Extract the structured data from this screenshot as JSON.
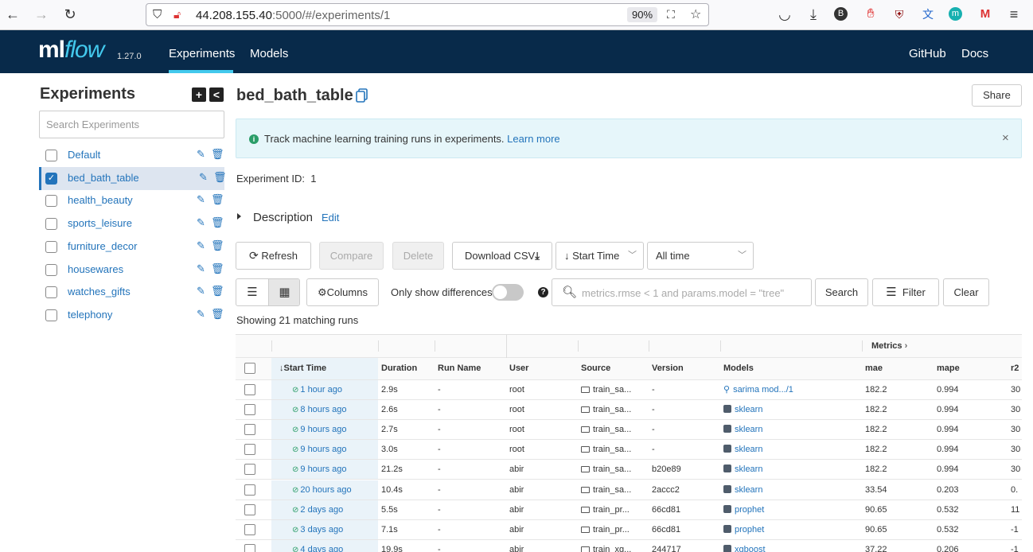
{
  "browser": {
    "url_host": "44.208.155.40",
    "url_rest": ":5000/#/experiments/1",
    "zoom": "90%"
  },
  "header": {
    "logo_ml": "ml",
    "logo_flow": "flow",
    "version": "1.27.0",
    "nav": [
      "Experiments",
      "Models"
    ],
    "right_links": [
      "GitHub",
      "Docs"
    ]
  },
  "sidebar": {
    "title": "Experiments",
    "search_placeholder": "Search Experiments",
    "items": [
      {
        "label": "Default",
        "checked": false
      },
      {
        "label": "bed_bath_table",
        "checked": true
      },
      {
        "label": "health_beauty",
        "checked": false
      },
      {
        "label": "sports_leisure",
        "checked": false
      },
      {
        "label": "furniture_decor",
        "checked": false
      },
      {
        "label": "housewares",
        "checked": false
      },
      {
        "label": "watches_gifts",
        "checked": false
      },
      {
        "label": "telephony",
        "checked": false
      }
    ]
  },
  "main": {
    "title": "bed_bath_table",
    "share": "Share",
    "banner_text": "Track machine learning training runs in experiments.",
    "banner_link": "Learn more",
    "experiment_id_label": "Experiment ID:",
    "experiment_id": "1",
    "description_label": "Description",
    "description_edit": "Edit",
    "toolbar": {
      "refresh": "Refresh",
      "compare": "Compare",
      "delete": "Delete",
      "download": "Download CSV",
      "sort": "Start Time",
      "time_range": "All time",
      "columns": "Columns",
      "only_diff": "Only show differences",
      "search_placeholder": "metrics.rmse < 1 and params.model = \"tree\"",
      "search": "Search",
      "filter": "Filter",
      "clear": "Clear"
    },
    "showing": "Showing 21 matching runs",
    "table": {
      "metrics_group": "Metrics",
      "columns": [
        "Start Time",
        "Duration",
        "Run Name",
        "User",
        "Source",
        "Version",
        "Models",
        "mae",
        "mape",
        "r2"
      ],
      "rows": [
        {
          "start": "1 hour ago",
          "duration": "2.9s",
          "run": "-",
          "user": "root",
          "source": "train_sa...",
          "version": "-",
          "model": "sarima mod.../1",
          "mae": "182.2",
          "mape": "0.994",
          "r2": "30"
        },
        {
          "start": "8 hours ago",
          "duration": "2.6s",
          "run": "-",
          "user": "root",
          "source": "train_sa...",
          "version": "-",
          "model": "sklearn",
          "mae": "182.2",
          "mape": "0.994",
          "r2": "30"
        },
        {
          "start": "9 hours ago",
          "duration": "2.7s",
          "run": "-",
          "user": "root",
          "source": "train_sa...",
          "version": "-",
          "model": "sklearn",
          "mae": "182.2",
          "mape": "0.994",
          "r2": "30"
        },
        {
          "start": "9 hours ago",
          "duration": "3.0s",
          "run": "-",
          "user": "root",
          "source": "train_sa...",
          "version": "-",
          "model": "sklearn",
          "mae": "182.2",
          "mape": "0.994",
          "r2": "30"
        },
        {
          "start": "9 hours ago",
          "duration": "21.2s",
          "run": "-",
          "user": "abir",
          "source": "train_sa...",
          "version": "b20e89",
          "model": "sklearn",
          "mae": "182.2",
          "mape": "0.994",
          "r2": "30"
        },
        {
          "start": "20 hours ago",
          "duration": "10.4s",
          "run": "-",
          "user": "abir",
          "source": "train_sa...",
          "version": "2accc2",
          "model": "sklearn",
          "mae": "33.54",
          "mape": "0.203",
          "r2": "0."
        },
        {
          "start": "2 days ago",
          "duration": "5.5s",
          "run": "-",
          "user": "abir",
          "source": "train_pr...",
          "version": "66cd81",
          "model": "prophet",
          "mae": "90.65",
          "mape": "0.532",
          "r2": "11"
        },
        {
          "start": "3 days ago",
          "duration": "7.1s",
          "run": "-",
          "user": "abir",
          "source": "train_pr...",
          "version": "66cd81",
          "model": "prophet",
          "mae": "90.65",
          "mape": "0.532",
          "r2": "-1"
        },
        {
          "start": "4 days ago",
          "duration": "19.9s",
          "run": "-",
          "user": "abir",
          "source": "train_xg...",
          "version": "244717",
          "model": "xgboost",
          "mae": "37.22",
          "mape": "0.206",
          "r2": "-1"
        }
      ]
    }
  }
}
